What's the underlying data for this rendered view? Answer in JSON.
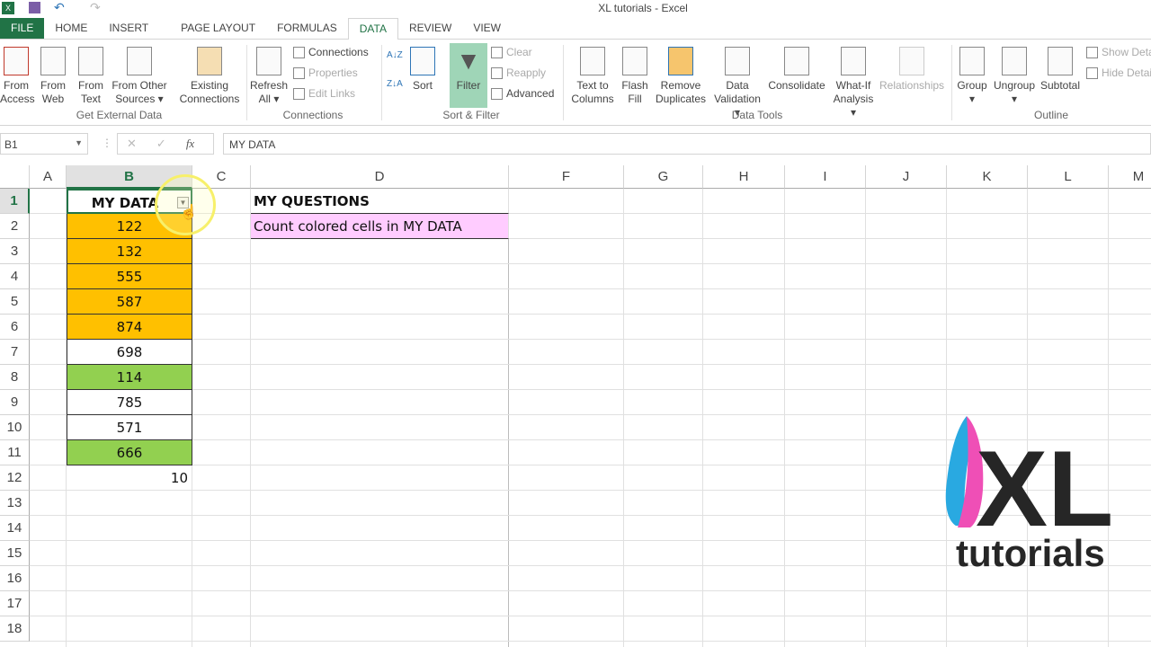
{
  "window": {
    "title": "XL tutorials - Excel"
  },
  "tabs": [
    "FILE",
    "HOME",
    "INSERT",
    "PAGE LAYOUT",
    "FORMULAS",
    "DATA",
    "REVIEW",
    "VIEW"
  ],
  "active_tab": "DATA",
  "ribbon": {
    "get_external_data": {
      "label": "Get External Data",
      "buttons": [
        "From Access",
        "From Web",
        "From Text",
        "From Other Sources"
      ]
    },
    "existing_connections": "Existing Connections",
    "connections": {
      "label": "Connections",
      "refresh": "Refresh All",
      "items": [
        "Connections",
        "Properties",
        "Edit Links"
      ]
    },
    "sort_filter": {
      "label": "Sort & Filter",
      "sort": "Sort",
      "filter": "Filter",
      "items": [
        "Clear",
        "Reapply",
        "Advanced"
      ]
    },
    "data_tools": {
      "label": "Data Tools",
      "buttons": [
        "Text to Columns",
        "Flash Fill",
        "Remove Duplicates",
        "Data Validation",
        "Consolidate",
        "What-If Analysis",
        "Relationships"
      ]
    },
    "outline": {
      "label": "Outline",
      "buttons": [
        "Group",
        "Ungroup",
        "Subtotal"
      ],
      "items": [
        "Show Detail",
        "Hide Detail"
      ]
    }
  },
  "formula_bar": {
    "name_box": "B1",
    "fx": "fx",
    "formula": "MY DATA"
  },
  "columns": [
    "A",
    "B",
    "C",
    "D",
    "F",
    "G",
    "H",
    "I",
    "J",
    "K",
    "L",
    "M"
  ],
  "rows": [
    "1",
    "2",
    "3",
    "4",
    "5",
    "6",
    "7",
    "8",
    "9",
    "10",
    "11",
    "12",
    "13",
    "14",
    "15",
    "16",
    "17",
    "18"
  ],
  "cells": {
    "B1": "MY DATA",
    "data": [
      {
        "v": "122",
        "fill": "#ffc000"
      },
      {
        "v": "132",
        "fill": "#ffc000"
      },
      {
        "v": "555",
        "fill": "#ffc000"
      },
      {
        "v": "587",
        "fill": "#ffc000"
      },
      {
        "v": "874",
        "fill": "#ffc000"
      },
      {
        "v": "698",
        "fill": "#ffffff"
      },
      {
        "v": "114",
        "fill": "#92d050"
      },
      {
        "v": "785",
        "fill": "#ffffff"
      },
      {
        "v": "571",
        "fill": "#ffffff"
      },
      {
        "v": "666",
        "fill": "#92d050"
      }
    ],
    "B12": "10",
    "D1": "MY QUESTIONS",
    "D2": "Count colored cells in MY DATA",
    "D2_fill": "#ffccff"
  },
  "logo": {
    "text1": "XL",
    "text2": "tutorials"
  }
}
